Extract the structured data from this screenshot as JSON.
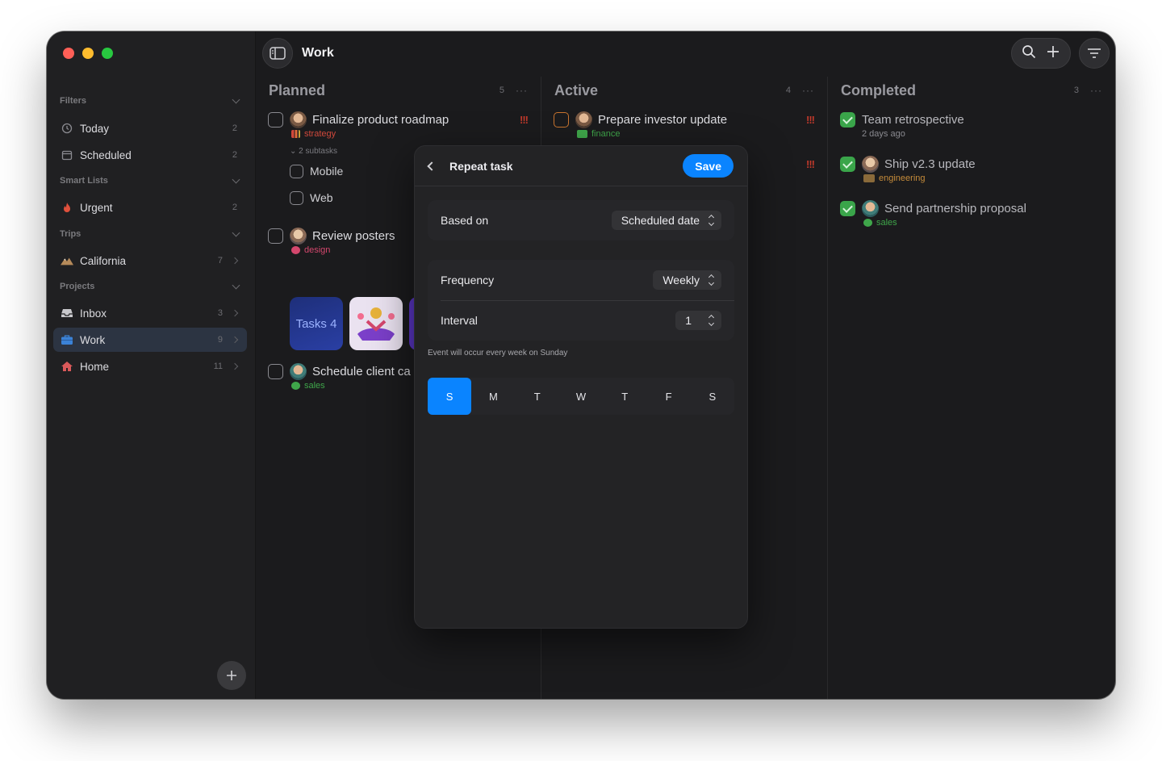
{
  "window": {
    "title": "Work"
  },
  "sidebar": {
    "sections": [
      {
        "title": "Filters"
      },
      {
        "title": "Smart Lists"
      },
      {
        "title": "Trips"
      },
      {
        "title": "Projects"
      }
    ],
    "items": [
      {
        "label": "Today",
        "count": "2",
        "icon": "clock-icon"
      },
      {
        "label": "Scheduled",
        "count": "2",
        "icon": "calendar-icon"
      },
      {
        "label": "Urgent",
        "count": "2",
        "icon": "flame-icon"
      },
      {
        "label": "California",
        "count": "7",
        "icon": "mountain-icon"
      },
      {
        "label": "Inbox",
        "count": "3",
        "icon": "inbox-icon"
      },
      {
        "label": "Work",
        "count": "9",
        "icon": "briefcase-icon"
      },
      {
        "label": "Home",
        "count": "11",
        "icon": "house-icon"
      }
    ]
  },
  "columns": [
    {
      "name": "Planned",
      "count": "5",
      "more": "···",
      "tasks": [
        {
          "title": "Finalize product roadmap",
          "tag": "strategy",
          "priority": "!!!",
          "subtasks_label": "2 subtasks"
        },
        {
          "title": "Review posters",
          "tag": "design"
        },
        {
          "title": "Schedule client ca",
          "tag": "sales"
        }
      ],
      "subtasks": [
        "Mobile",
        "Web"
      ],
      "thumb_text": "Tasks 4"
    },
    {
      "name": "Active",
      "count": "4",
      "more": "···",
      "tasks": [
        {
          "title": "Prepare investor update",
          "tag": "finance",
          "priority": "!!!"
        },
        {
          "priority": "!!!"
        }
      ]
    },
    {
      "name": "Completed",
      "count": "3",
      "more": "···",
      "tasks": [
        {
          "title": "Team retrospective",
          "meta": "2 days ago"
        },
        {
          "title": "Ship v2.3 update",
          "tag": "engineering"
        },
        {
          "title": "Send partnership proposal",
          "tag": "sales"
        }
      ]
    }
  ],
  "modal": {
    "title": "Repeat task",
    "save_label": "Save",
    "based_on_label": "Based on",
    "based_on_value": "Scheduled date",
    "frequency_label": "Frequency",
    "frequency_value": "Weekly",
    "interval_label": "Interval",
    "interval_value": "1",
    "note": "Event will occur every week on Sunday",
    "days": [
      "S",
      "M",
      "T",
      "W",
      "T",
      "F",
      "S"
    ],
    "selected_day_index": 0
  },
  "colors": {
    "accent": "#0a84ff",
    "priority": "#c0392b",
    "done": "#3aa54a",
    "tag_strategy": "#d0483b",
    "tag_design": "#d4476d",
    "tag_finance": "#3fa64a",
    "tag_sales": "#3fa64a",
    "tag_engineering": "#c58b3a"
  }
}
